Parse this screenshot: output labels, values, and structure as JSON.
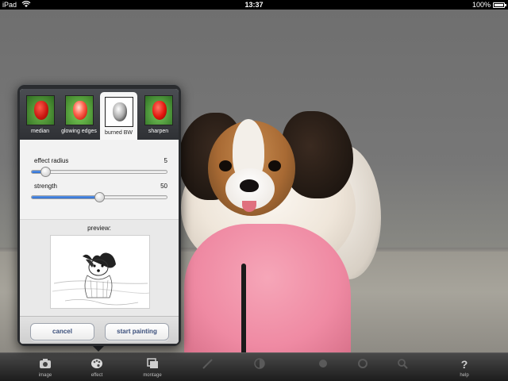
{
  "statusbar": {
    "carrier": "iPad",
    "time": "13:37",
    "battery": "100%"
  },
  "popover": {
    "effects": [
      {
        "label": "median",
        "icon": "tulip-median-thumbnail",
        "selected": false
      },
      {
        "label": "glowing edges",
        "icon": "tulip-glowing-edges-thumbnail",
        "selected": false
      },
      {
        "label": "burned BW",
        "icon": "tulip-burned-bw-thumbnail",
        "selected": true
      },
      {
        "label": "sharpen",
        "icon": "tulip-sharpen-thumbnail",
        "selected": false
      }
    ],
    "sliders": [
      {
        "label": "effect radius",
        "value": "5",
        "fraction": 0.1
      },
      {
        "label": "strength",
        "value": "50",
        "fraction": 0.5
      }
    ],
    "preview_label": "preview:",
    "cancel_label": "cancel",
    "start_label": "start painting"
  },
  "toolbar": {
    "items": [
      {
        "label": "image",
        "icon": "camera-icon",
        "enabled": true
      },
      {
        "label": "effect",
        "icon": "palette-icon",
        "enabled": true
      },
      {
        "label": "montage",
        "icon": "layers-icon",
        "enabled": true
      },
      {
        "label": "",
        "icon": "brush-icon",
        "enabled": false
      },
      {
        "label": "",
        "icon": "circle-half-icon",
        "enabled": false
      },
      {
        "label": "",
        "icon": "dot-icon",
        "enabled": false
      },
      {
        "label": "",
        "icon": "ring-icon",
        "enabled": false
      },
      {
        "label": "",
        "icon": "magnifier-icon",
        "enabled": false
      },
      {
        "label": "help",
        "icon": "question-icon",
        "enabled": true
      }
    ]
  },
  "colors": {
    "accent": "#2c6ed0",
    "button_text": "#3a4e7a",
    "popover_frame": "#2a2c2f"
  }
}
